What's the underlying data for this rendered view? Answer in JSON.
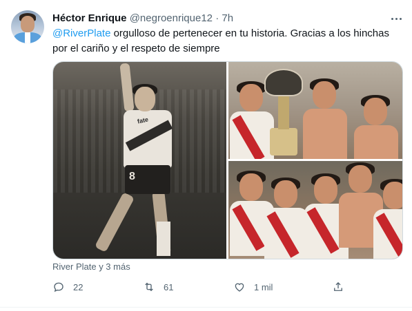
{
  "tweet": {
    "author_name": "Héctor Enrique",
    "handle": "@negroenrique12",
    "separator": "·",
    "time": "7h",
    "mention": "@RiverPlate",
    "body": " orgulloso de pertenecer en tu historia. Gracias a los hinchas por el cariño y el respeto de siempre",
    "media_caption": "River Plate y 3 más",
    "photo_text": {
      "jersey_sponsor": "fate",
      "shorts_number": "8"
    }
  },
  "actions": {
    "reply_count": "22",
    "retweet_count": "61",
    "like_count": "1 mil"
  },
  "icons": {
    "more": "more-horizontal-icon",
    "reply": "reply-icon",
    "retweet": "retweet-icon",
    "like": "heart-icon",
    "share": "share-icon"
  },
  "colors": {
    "link": "#1d9bf0",
    "secondary_text": "#536471",
    "primary_text": "#0f1419"
  }
}
